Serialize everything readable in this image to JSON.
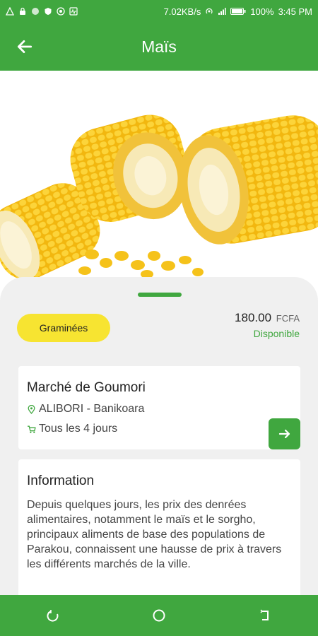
{
  "status_bar": {
    "network_speed": "7.02KB/s",
    "battery": "100%",
    "time": "3:45 PM"
  },
  "app_bar": {
    "title": "Maïs",
    "back_icon": "arrow-left-icon"
  },
  "product": {
    "category": "Graminées",
    "price": "180.00",
    "currency": "FCFA",
    "availability": "Disponible"
  },
  "market": {
    "name": "Marché de Goumori",
    "location": "ALIBORI - Banikoara",
    "frequency": "Tous les 4 jours",
    "location_icon": "map-pin-icon",
    "frequency_icon": "cart-icon",
    "open_icon": "arrow-right-icon"
  },
  "information": {
    "title": "Information",
    "text": "Depuis quelques jours, les prix des denrées alimentaires, notamment le maïs et le sorgho, principaux aliments de base des populations de Parakou, connaissent une hausse de prix à travers les différents marchés de la ville."
  },
  "colors": {
    "primary": "#40a73f",
    "category_badge": "#f7e431"
  }
}
